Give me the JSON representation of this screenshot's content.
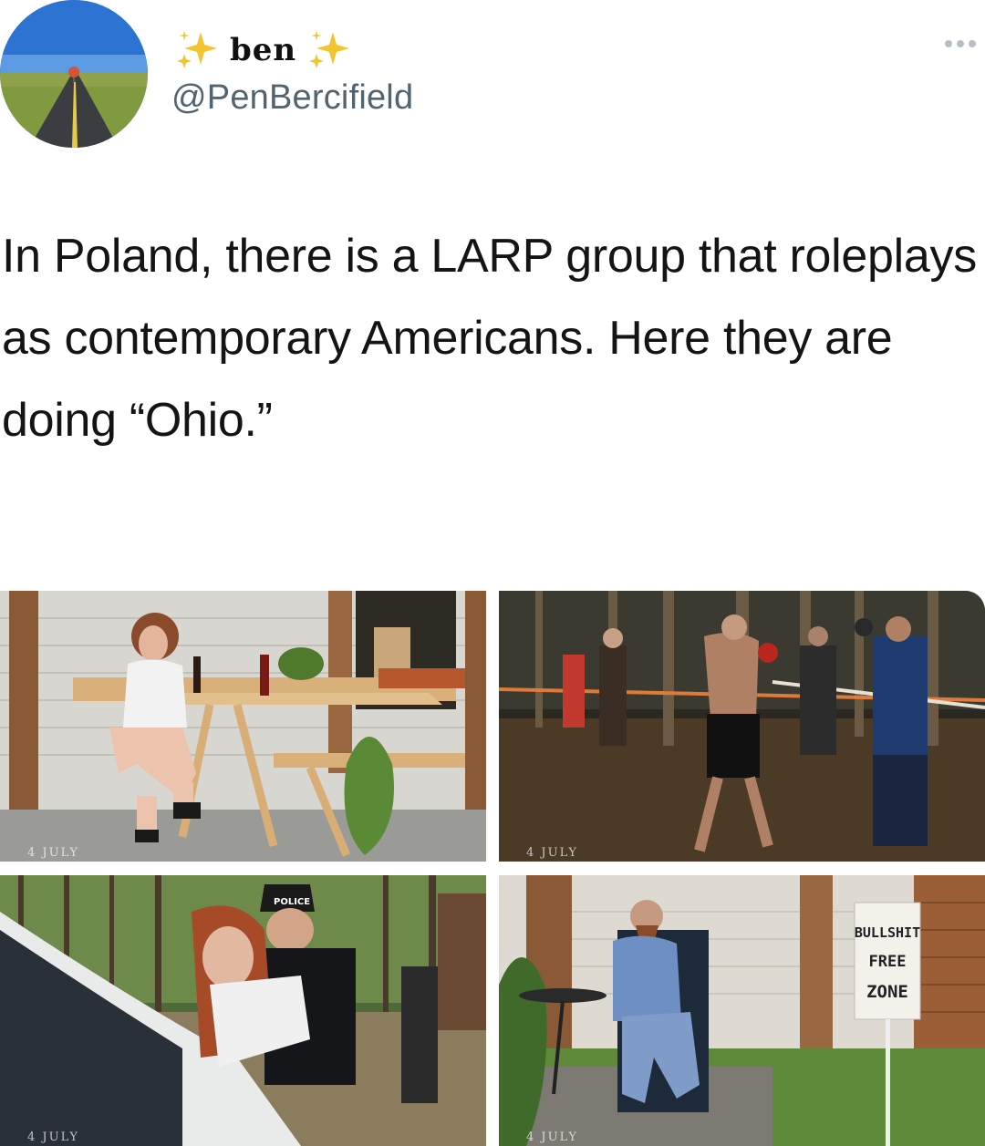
{
  "tweet": {
    "display_name": "ben",
    "handle": "@PenBercifield",
    "text": "In Poland, there is a LARP group that roleplays as contemporary Americans. Here they are doing “Ohio.”"
  },
  "media": {
    "sign_text": [
      "BULLSHIT",
      "FREE",
      "ZONE"
    ],
    "cap_text": "POLICE",
    "watermarks": [
      "4 JULY",
      "4 JULY",
      "4 JULY",
      "4 JULY"
    ]
  },
  "icons": [
    "sparkles-icon",
    "more-options-icon"
  ],
  "colors": {
    "handle": "#536471",
    "sparkle": "#f4c430"
  }
}
